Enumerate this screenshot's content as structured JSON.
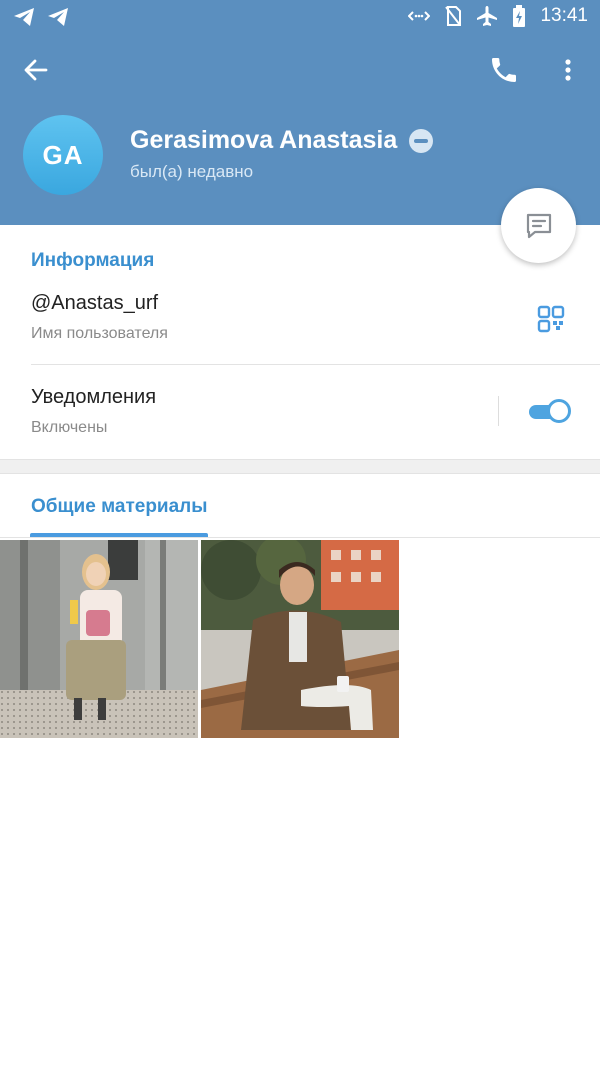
{
  "status_bar": {
    "time": "13:41"
  },
  "contact": {
    "initials": "GA",
    "name": "Gerasimova Anastasia",
    "last_seen": "был(а) недавно"
  },
  "info": {
    "section_title": "Информация",
    "username": "@Anastas_urf",
    "username_label": "Имя пользователя",
    "notifications_title": "Уведомления",
    "notifications_state": "Включены",
    "notifications_on": true
  },
  "shared_media": {
    "tab_label": "Общие материалы",
    "items": [
      {
        "kind": "photo",
        "description_icon": "photo-elevator-selfie"
      },
      {
        "kind": "photo",
        "description_icon": "photo-man-on-bench"
      }
    ]
  },
  "colors": {
    "header": "#5b8fbf",
    "accent": "#3a8fcf",
    "avatar": "#3aa7df",
    "toggle": "#4ea4e0"
  }
}
